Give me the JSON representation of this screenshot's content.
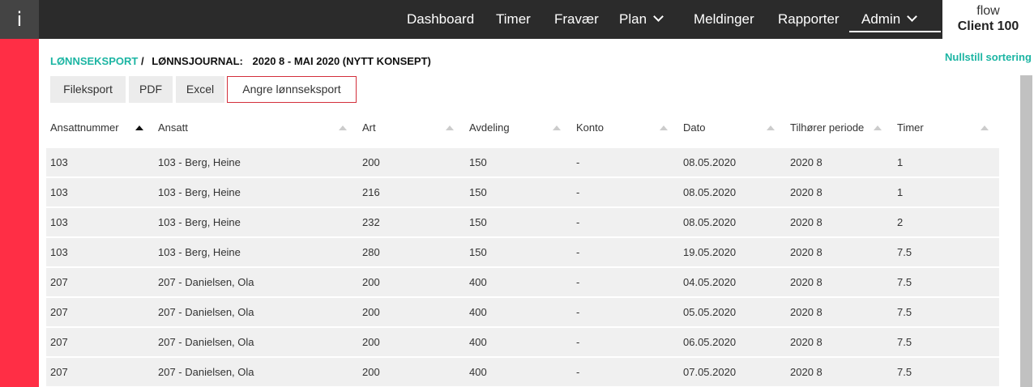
{
  "nav": {
    "info_label": "i",
    "items": [
      "Dashboard",
      "Timer",
      "Fravær",
      "Plan",
      "Meldinger",
      "Rapporter",
      "Admin"
    ],
    "client_line1": "flow",
    "client_line2": "Client 100"
  },
  "breadcrumb": {
    "link": "LØNNSEKSPORT",
    "separator": "/",
    "label": "LØNNSJOURNAL:",
    "value": "2020 8 - MAI 2020 (NYTT KONSEPT)"
  },
  "reset_sort": "Nullstill sortering",
  "buttons": [
    "Fileksport",
    "PDF",
    "Excel",
    "Angre lønnseksport"
  ],
  "table": {
    "headers": [
      "Ansattnummer",
      "Ansatt",
      "Art",
      "Avdeling",
      "Konto",
      "Dato",
      "Tilhører periode",
      "Timer"
    ],
    "active_sort_column": "Ansattnummer",
    "rows": [
      [
        "103",
        "103 - Berg, Heine",
        "200",
        "150",
        "-",
        "08.05.2020",
        "2020 8",
        "1"
      ],
      [
        "103",
        "103 - Berg, Heine",
        "216",
        "150",
        "-",
        "08.05.2020",
        "2020 8",
        "1"
      ],
      [
        "103",
        "103 - Berg, Heine",
        "232",
        "150",
        "-",
        "08.05.2020",
        "2020 8",
        "2"
      ],
      [
        "103",
        "103 - Berg, Heine",
        "280",
        "150",
        "-",
        "19.05.2020",
        "2020 8",
        "7.5"
      ],
      [
        "207",
        "207 - Danielsen, Ola",
        "200",
        "400",
        "-",
        "04.05.2020",
        "2020 8",
        "7.5"
      ],
      [
        "207",
        "207 - Danielsen, Ola",
        "200",
        "400",
        "-",
        "05.05.2020",
        "2020 8",
        "7.5"
      ],
      [
        "207",
        "207 - Danielsen, Ola",
        "200",
        "400",
        "-",
        "06.05.2020",
        "2020 8",
        "7.5"
      ],
      [
        "207",
        "207 - Danielsen, Ola",
        "200",
        "400",
        "-",
        "07.05.2020",
        "2020 8",
        "7.5"
      ]
    ]
  },
  "colors": {
    "topbar": "#2b2b2b",
    "accent_red": "#ff2e45",
    "accent_teal": "#1cb5a3",
    "row_bg": "#f0f0f0"
  }
}
